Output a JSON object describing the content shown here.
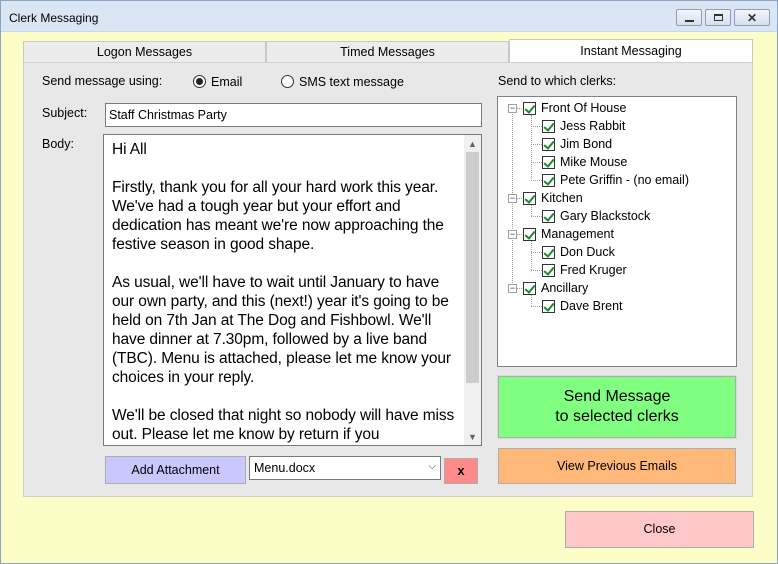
{
  "window": {
    "title": "Clerk Messaging",
    "controls": [
      "minimize",
      "maximize",
      "close"
    ]
  },
  "tabs": [
    {
      "label": "Logon Messages",
      "active": false
    },
    {
      "label": "Timed Messages",
      "active": false
    },
    {
      "label": "Instant Messaging",
      "active": true
    }
  ],
  "send_using": {
    "label": "Send message using:",
    "options": [
      {
        "label": "Email",
        "selected": true
      },
      {
        "label": "SMS text message",
        "selected": false
      }
    ]
  },
  "subject": {
    "label": "Subject:",
    "value": "Staff Christmas Party"
  },
  "body": {
    "label": "Body:",
    "value": "Hi All\n\nFirstly, thank you for all your hard work this year. We've had a tough year but your effort and dedication has meant we're now approaching the festive season in good shape.\n\nAs usual, we'll have to wait until January to have our own party, and this (next!) year it's going to be held on 7th Jan at The Dog and Fishbowl. We'll have dinner at 7.30pm, followed by a live band (TBC). Menu is attached, please let me know your choices in your reply.\n\nWe'll be closed that night so nobody will have miss out. Please let me know by return if you"
  },
  "attachment": {
    "add_label": "Add Attachment",
    "selected_file": "Menu.docx",
    "remove_label": "x"
  },
  "recipients": {
    "label": "Send to which clerks:",
    "groups": [
      {
        "name": "Front Of House",
        "checked": true,
        "expanded": true,
        "members": [
          {
            "name": "Jess Rabbit",
            "checked": true
          },
          {
            "name": "Jim Bond",
            "checked": true
          },
          {
            "name": "Mike Mouse",
            "checked": true
          },
          {
            "name": "Pete Griffin - (no email)",
            "checked": true
          }
        ]
      },
      {
        "name": "Kitchen",
        "checked": true,
        "expanded": true,
        "members": [
          {
            "name": "Gary Blackstock",
            "checked": true
          }
        ]
      },
      {
        "name": "Management",
        "checked": true,
        "expanded": true,
        "members": [
          {
            "name": "Don Duck",
            "checked": true
          },
          {
            "name": "Fred Kruger",
            "checked": true
          }
        ]
      },
      {
        "name": "Ancillary",
        "checked": true,
        "expanded": true,
        "members": [
          {
            "name": "Dave Brent",
            "checked": true
          }
        ]
      }
    ]
  },
  "buttons": {
    "send_line1": "Send Message",
    "send_line2": "to selected clerks",
    "history": "View Previous Emails",
    "close": "Close"
  },
  "colors": {
    "window_bg": "#fdfdc8",
    "send_button": "#80ff80",
    "history_button": "#ffb878",
    "close_button": "#ffc8c8",
    "attach_button": "#c8c8ff",
    "remove_button": "#ff8a8a"
  }
}
